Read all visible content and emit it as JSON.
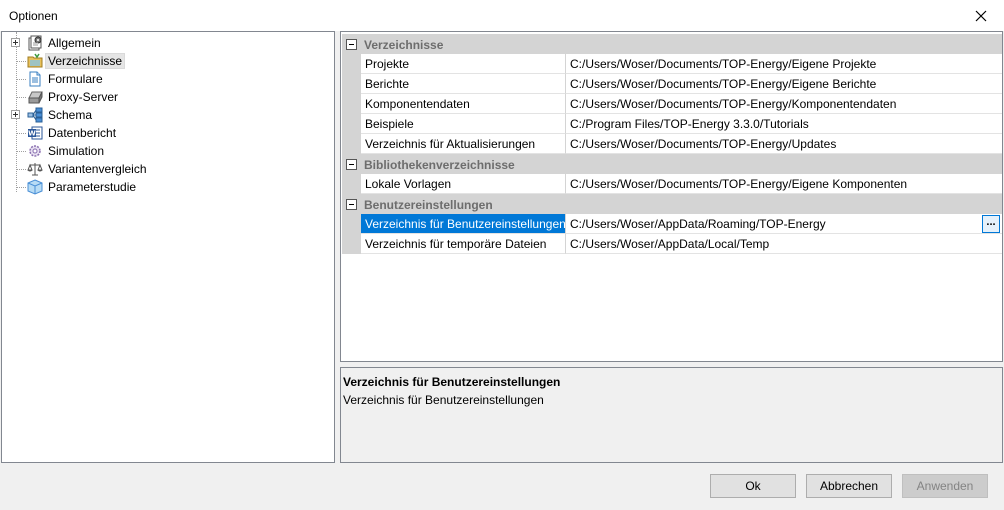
{
  "window": {
    "title": "Optionen",
    "close_icon": "close-icon"
  },
  "tree": {
    "items": [
      {
        "label": "Allgemein",
        "icon": "settings-page-icon",
        "expandable": true,
        "selected": false
      },
      {
        "label": "Verzeichnisse",
        "icon": "folder-icon",
        "expandable": false,
        "selected": true
      },
      {
        "label": "Formulare",
        "icon": "form-document-icon",
        "expandable": false,
        "selected": false
      },
      {
        "label": "Proxy-Server",
        "icon": "server-icon",
        "expandable": false,
        "selected": false
      },
      {
        "label": "Schema",
        "icon": "schema-diagram-icon",
        "expandable": true,
        "selected": false
      },
      {
        "label": "Datenbericht",
        "icon": "word-document-icon",
        "expandable": false,
        "selected": false
      },
      {
        "label": "Simulation",
        "icon": "gear-icon",
        "expandable": false,
        "selected": false
      },
      {
        "label": "Variantenvergleich",
        "icon": "balance-scale-icon",
        "expandable": false,
        "selected": false
      },
      {
        "label": "Parameterstudie",
        "icon": "cube-icon",
        "expandable": false,
        "selected": false
      }
    ]
  },
  "grid": {
    "categories": [
      {
        "label": "Verzeichnisse",
        "rows": [
          {
            "name": "Projekte",
            "value": "C:/Users/Woser/Documents/TOP-Energy/Eigene Projekte"
          },
          {
            "name": "Berichte",
            "value": "C:/Users/Woser/Documents/TOP-Energy/Eigene Berichte"
          },
          {
            "name": "Komponentendaten",
            "value": "C:/Users/Woser/Documents/TOP-Energy/Komponentendaten"
          },
          {
            "name": "Beispiele",
            "value": "C:/Program Files/TOP-Energy 3.3.0/Tutorials"
          },
          {
            "name": "Verzeichnis für Aktualisierungen",
            "value": "C:/Users/Woser/Documents/TOP-Energy/Updates"
          }
        ]
      },
      {
        "label": "Bibliothekenverzeichnisse",
        "rows": [
          {
            "name": "Lokale Vorlagen",
            "value": "C:/Users/Woser/Documents/TOP-Energy/Eigene Komponenten"
          }
        ]
      },
      {
        "label": "Benutzereinstellungen",
        "rows": [
          {
            "name": "Verzeichnis für Benutzereinstellungen",
            "value": "C:/Users/Woser/AppData/Roaming/TOP-Energy",
            "selected": true,
            "browse_label": "..."
          },
          {
            "name": "Verzeichnis für temporäre Dateien",
            "value": "C:/Users/Woser/AppData/Local/Temp"
          }
        ]
      }
    ]
  },
  "description": {
    "title": "Verzeichnis für Benutzereinstellungen",
    "text": "Verzeichnis für Benutzereinstellungen"
  },
  "buttons": {
    "ok": "Ok",
    "cancel": "Abbrechen",
    "apply": "Anwenden",
    "apply_enabled": false
  },
  "colors": {
    "selection": "#0078d7",
    "category_bg": "#d4d4d4"
  }
}
